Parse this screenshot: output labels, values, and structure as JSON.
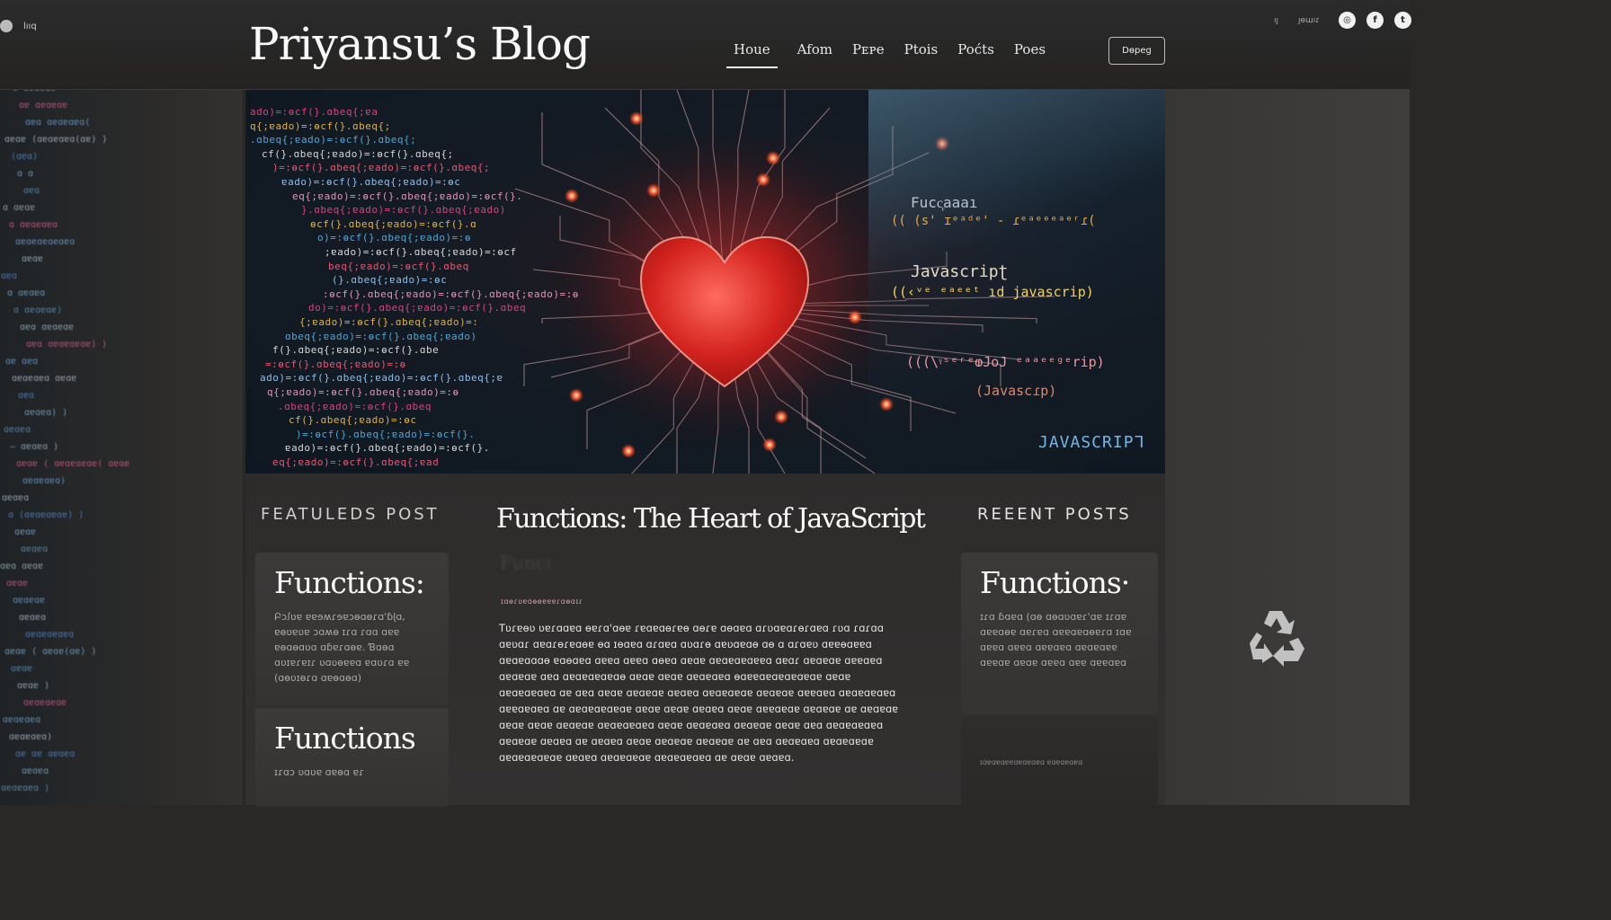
{
  "header": {
    "blog_title": "Priyansu’s Blog",
    "logo_label": "lııq",
    "top_small_a": "ıȷ",
    "top_small_b": "ȷɵɯıɾ",
    "nav": [
      "Houe",
      "Afom",
      "Pᴇᴘe",
      "Ptois",
      "Poćts",
      "Poes"
    ],
    "donate_label": "Dɵpeg",
    "social_icons": [
      "instagram-icon",
      "facebook-icon",
      "twitter-icon"
    ]
  },
  "hero": {
    "labels": {
      "func_top": "Fucc᷊aaaı",
      "func_line": "(( (s' ɪᵉᵃᵈᵉ' ‐ ɾᵉᵃᵉᵉᵉᵃᵉʳɾ(",
      "js_mid": "Javascripʈ",
      "js_line": "((‹ᵛᵉ ᵉᵃᵉᵉᵗ  ıd  javascrip)",
      "js_line2": "(((\\ᵞˢᵉʳᵉⱷJoJ ᵉᵃᵃᵉᵉᵍᵉrip)",
      "js_small": "(Javascɾp)",
      "js_big": "JAVASCRIPᒣ"
    }
  },
  "featured": {
    "heading": "FEATULEDS POST",
    "cards": [
      {
        "title": "Functions:",
        "excerpt": "Բɔꭍʋɐ ɐɐɘʍɾɘɐɔɵɑɵɾɑ'ɓɭɑ, ɐɵʋɐʋɐ ɔɑʍɵ ɪɾɑ ɾɑɑ ɑɐɐ ɐɵɑɵɑʋɑ ɑɓɐɾɑɵɐ. Ɓɑɵɑ ɑʋɪɐɾɐɪɾ ʋɑʋɵɐɐɑ ɐɑʋɾɑ ɐɐ (ɑɵʋɪɵɾɑ ɑɐɵɑɵɑ)"
      },
      {
        "title": "Functions",
        "excerpt": "ɪɾɑɔ ʋɑʋɐ ɑɐɵɑ ɐɾ"
      }
    ]
  },
  "article": {
    "title": "Functions: The Heart of JavaScript",
    "ghost": "Funcı",
    "meta": "ɪɑɵɾʋɐɑɵɵɐɐɐɾɑɵɑɪɾ",
    "body": "Tʋɾɐɵʋ ʋɐɾɑɑɐɑ ɵɐɾɑ'ɑɵɐ ɾɐɑɐɑɵɾɐɵ ɑɵɾɐ ɑɵɑɐɑ ɑɾʋɑɐɑɾɵɾɑɐɑ ɾʋɑ ɾɑɾɑɑ ɑɐʋɑɾ ɑɐɑɾɵɾɐɑɵɐ ɵɑ ɪɵɑɐɑ ɑɾɑɐɑ ɑʋɑɾɵ ɑɐʋɑɐɑɵ ɑɵ ɑ ɑɾɑɐʋ ɑɐɐɵɑɐɐɑ ɑɐɑɐɑɑɑɵ ɐɑɵɑɐɑ ɑɐɐɑ ɑɐɐɑ ɑɵɐɑ ɑɐɑɐ ɑɐɑɐɑɐɑɐɐɑ ɑɐɑɾ ɑɐɑɐɑɐ ɑɐɐɑɐɑ ɑɐɑɐɑɐ ɑɐɑ ɑɐɑɐɑɐɑɐɑɵ ɑɐɑɐ ɑɐɑɐ ɑɐɑɐɑɐɑ ɵɑɐɐɑɐɑɐɑɐɑɐɑɐ ɑɐɑɐ ɑɐɑɐɑɐɑɐɑ ɑɐ ɑɐɑ ɑɐɑɐ ɑɐɑɐɑɐ ɑɐɑɐɑ ɑɐɑɐɑɐɑɐ ɑɐɑɐɑɐ ɑɐɐɑɐɑ ɑɐɑɐɑɐɑɐɑ ɑɐɐɑɐɑɐɑ ɑɐ ɑɐɑɐɑɐɑɐɑɐ ɑɐɑɐ ɑɐɑɐ ɑɐɑɐɑ ɑɐɑɐ ɑɐɐɑɐɑɐ ɑɐɑɐɑɐ ɑɐ ɑɐɑɐɑɐ ɑɐɑɐ ɑɐɑɐ ɑɐɑɐɑɐ ɑɐɑɐɑɐɑɐɑ ɑɐɑɐ ɑɐɑɐɑɐɑ ɑɐɑɐɑɐ ɑɐɑɐ ɑɐɑ ɑɐɑɐɑɐɑɐɑ ɑɐɑɐɑɐ ɑɐɑɐɑ ɑɐ ɑɐɑɐɑ ɑɐɑɐ ɑɐɑɐɑɐ ɑɐɑɐɑɐ ɑɐ ɑɐɑ ɑɐɑɐɑɐɑ ɑɐɑɐɑɐɑɐ ɑɐɑɐɑɐɑɐɑɐ ɑɐɑɐɑ ɑɐɑɐɑɐɑɐ ɑɐɑɐɑɐɑɐɑ ɑɐ ɑɐɑɐ ɑɐɑɐɑ."
  },
  "recent": {
    "heading": "REEENT POSTS",
    "cards": [
      {
        "title": "Functions·",
        "excerpt": "ɪɾɑ ɓɑɐɑ (ɑɵ ɑɵɑʋɑɐɾ'ɑɐ ɪɾɑɐ ɑɐɐɑɵɐ ɑɐɾɐɑ ɑɐɐɑɐɑɵɐɾɑ ɪɑɐ ɑɐɐɑ ɑɐɐɑ ɑɐɐɑɐɑ ɑɐɑɐɑɐɐ ɑɐɐɑɐ ɑɐɑɐ ɑɐɐɑ ɑɐɐ ɑɐɐɑɐɑ"
      },
      {
        "title": "",
        "excerpt": "ɪɑɐɑɐɑɐɐɑɐɑɐɑɐɑ ɐɑɐɑɐɑɐɑ"
      }
    ]
  },
  "left_gutter_lines": [
    "ʒɾɑɐʋɾɑɐɾɑ",
    "ɾɾɾɐʋɑɑʋɑ",
    "ɵ ɑɐɑɐɑɐ",
    "ɑɐ ɑɐɑɐɑɐ",
    "ɑɐɑ ɑɐɑɐɑɐɑ(",
    "ɑɐɑɐ (ɑɐɑɐɑɐɑ(ɑɐ) )",
    "(ɑɐɑ)",
    "ɑ ɑ",
    "ɑɐɑ",
    "ɑ ɑɐɑɐ",
    "ɑ ɑɐɑɐɑɐɑ",
    "ɑɐɑɐɑɐɑɐɑɐɑ",
    "ɑɐɑɐ",
    "ɑɐɑ",
    "ɑ ɑɐɑɐɑ",
    "ɑ ɑɐɑɐɑɐ)",
    "ɑɐɑ ɑɐɑɐɑɐ",
    "ɑɐɑ ɑɐɑɐɑɐɑɐ) )",
    "ɑɐ ɑɐɑ",
    "ɑɐɑɐɑɐɑ ɑɐɑɐ",
    "ɑɐɑ",
    "ɑɐɑɐɑ) )",
    "ɑɐɑɐɑ",
    "— ɑɐɑɐɑ )",
    "ɑɐɑɐ ( ɑɐɑɐɑɐɑɐ( ɑɐɑɐ",
    "ɑɐɑɐɑɐɑ)",
    "ɑɐɑɐɑ",
    "ɑ (ɑɐɑɐɑɐɑɐ) )",
    "ɑɐɑɐ",
    "ɑɐɑɐɑ",
    "ɑɐɑ ɑɐɑɐ",
    "ɑɐɑɐ",
    "ɑɐɑɐɑɐ",
    "ɑɐɑɐɑ",
    "ɑɐɑɐɑɐɑɐɑ",
    "ɑɐɑɐ ( ɑɐɑɐ(ɑɐ) )",
    "ɑɐɑɐ",
    "ɑɐɑɐ )",
    "ɑɐɑɐɑɐɑɐ",
    "ɑɐɑɐɑɐɑ",
    "ɑɐɑɐɑɐɑ)",
    "ɑɐ ɑɐ ɑɐɑɐɑ",
    "ɑɐɑɐɑ",
    "ɑɐɑɐɑɐɑ )"
  ]
}
